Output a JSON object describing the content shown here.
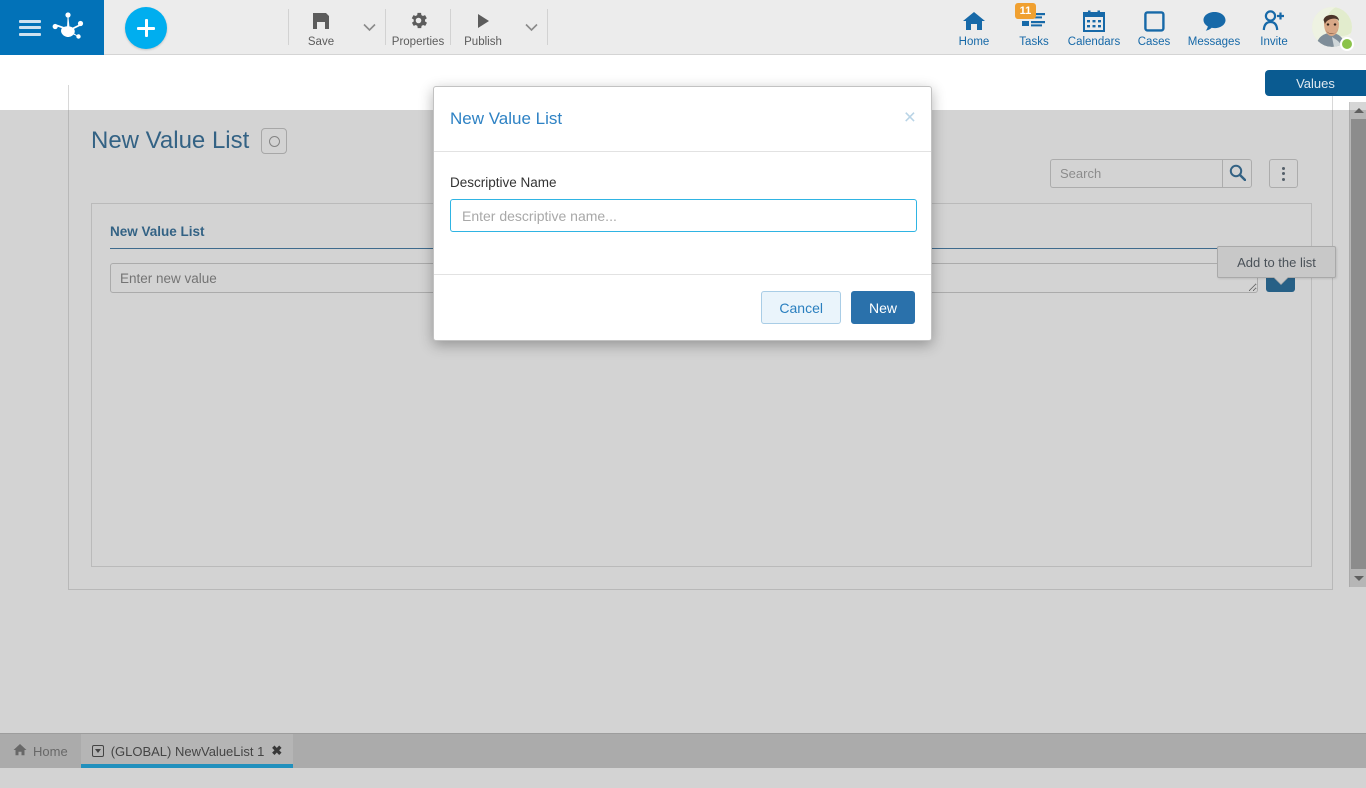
{
  "app": {
    "logo_icon": "bonita-frog-logo",
    "menu_icon": "hamburger-menu-icon",
    "add_icon": "plus-icon"
  },
  "toolbar": {
    "items": [
      {
        "label": "Save",
        "icon": "floppy-disk-icon",
        "has_caret": true
      },
      {
        "label": "Properties",
        "icon": "gear-icon",
        "has_caret": false
      },
      {
        "label": "Publish",
        "icon": "play-triangle-icon",
        "has_caret": true
      }
    ],
    "right_items": [
      {
        "label": "Home",
        "icon": "house-icon",
        "badge": ""
      },
      {
        "label": "Tasks",
        "icon": "task-list-icon",
        "badge": "11"
      },
      {
        "label": "Calendars",
        "icon": "calendar-icon",
        "badge": ""
      },
      {
        "label": "Cases",
        "icon": "square-outline-icon",
        "badge": ""
      },
      {
        "label": "Messages",
        "icon": "speech-bubble-icon",
        "badge": ""
      },
      {
        "label": "Invite",
        "icon": "person-add-icon",
        "badge": ""
      }
    ],
    "avatar_name": "user-avatar",
    "status": "online"
  },
  "workspace": {
    "values_tab_label": "Values",
    "page_title": "New Value List",
    "title_badge_icon": "circle-outline-icon",
    "search": {
      "placeholder": "Search",
      "value": "",
      "icon": "magnifier-icon"
    },
    "kebab_icon": "vertical-dots-icon",
    "panel": {
      "section_label": "New Value List",
      "value_placeholder": "Enter new value",
      "value": "",
      "add_button_icon": "check-icon"
    },
    "tooltip": "Add to the list",
    "scrollbar": {
      "up_icon": "triangle-up-icon",
      "down_icon": "triangle-down-icon"
    }
  },
  "modal": {
    "title": "New Value List",
    "close_label": "×",
    "field_label": "Descriptive Name",
    "field_placeholder": "Enter descriptive name...",
    "field_value": "",
    "cancel_label": "Cancel",
    "confirm_label": "New"
  },
  "taskbar": {
    "home_label": "Home",
    "home_icon": "home-icon",
    "tab_label": "(GLOBAL) NewValueList 1",
    "tab_icon": "dropdown-square-icon",
    "tab_close_icon": "close-x-icon"
  },
  "colors": {
    "brand_blue": "#0272b8",
    "accent_cyan": "#00aeef",
    "dark_blue": "#0a5b91",
    "link_blue": "#1769a8",
    "badge_orange": "#f0a030",
    "status_green": "#8bc34a"
  }
}
